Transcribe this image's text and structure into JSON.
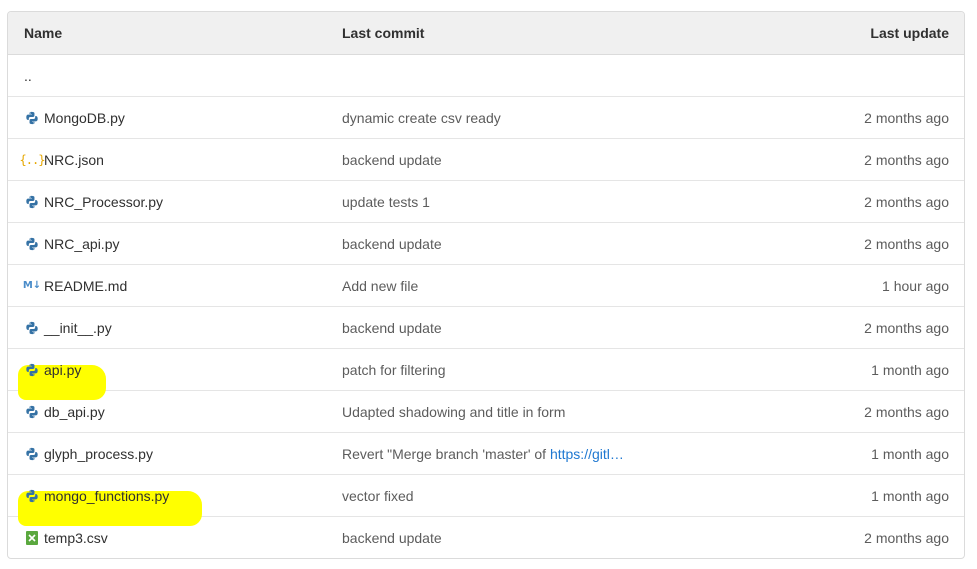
{
  "header": {
    "name": "Name",
    "last_commit": "Last commit",
    "last_update": "Last update"
  },
  "parent_dir": "..",
  "files": [
    {
      "name": "MongoDB.py",
      "icon": "python-icon",
      "commit": "dynamic create csv ready",
      "updated": "2 months ago"
    },
    {
      "name": "NRC.json",
      "icon": "json-icon",
      "commit": "backend update",
      "updated": "2 months ago"
    },
    {
      "name": "NRC_Processor.py",
      "icon": "python-icon",
      "commit": "update tests 1",
      "updated": "2 months ago"
    },
    {
      "name": "NRC_api.py",
      "icon": "python-icon",
      "commit": "backend update",
      "updated": "2 months ago"
    },
    {
      "name": "README.md",
      "icon": "markdown-icon",
      "commit": "Add new file",
      "updated": "1 hour ago"
    },
    {
      "name": "__init__.py",
      "icon": "python-icon",
      "commit": "backend update",
      "updated": "2 months ago"
    },
    {
      "name": "api.py",
      "icon": "python-icon",
      "commit": "patch for filtering",
      "updated": "1 month ago",
      "highlighted": true
    },
    {
      "name": "db_api.py",
      "icon": "python-icon",
      "commit": "Udapted shadowing and title in form",
      "updated": "2 months ago"
    },
    {
      "name": "glyph_process.py",
      "icon": "python-icon",
      "commit": "Revert \"Merge branch 'master' of ",
      "commit_link": "https://gitl…",
      "updated": "1 month ago"
    },
    {
      "name": "mongo_functions.py",
      "icon": "python-icon",
      "commit": "vector fixed",
      "updated": "1 month ago",
      "highlighted": true
    },
    {
      "name": "temp3.csv",
      "icon": "csv-icon",
      "commit": "backend update",
      "updated": "2 months ago"
    }
  ],
  "colors": {
    "highlight": "#ffff00",
    "link": "#1f78d1",
    "header_bg": "#f0f0f0"
  }
}
